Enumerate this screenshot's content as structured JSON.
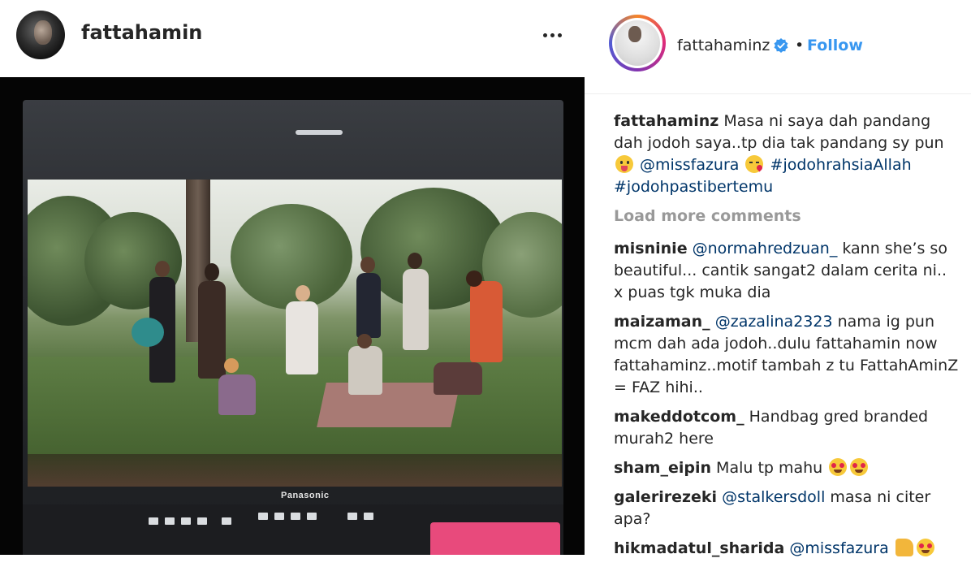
{
  "post": {
    "username": "fattahamin",
    "more_label": "•••"
  },
  "photo": {
    "monitor_brand": "Panasonic"
  },
  "sidebar": {
    "username": "fattahaminz",
    "bullet": "•",
    "follow_label": "Follow",
    "verified_icon": "verified-badge-icon",
    "accent_color": "#3897f0",
    "caption": {
      "username": "fattahaminz",
      "text_1": "Masa ni saya dah pandang dah jodoh saya..tp dia tak pandang sy pun",
      "mention": "@missfazura",
      "tag_1": "#jodohrahsiaAllah",
      "tag_2": "#jodohpastibertemu"
    },
    "load_more": "Load more comments",
    "comments": [
      {
        "username": "misninie",
        "mention": "@normahredzuan_",
        "text": "kann she’s so beautiful... cantik sangat2 dalam cerita ni.. x puas tgk muka dia"
      },
      {
        "username": "maizaman_",
        "mention": "@zazalina2323",
        "text": "nama ig pun mcm dah ada jodoh..dulu fattahamin now fattahaminz..motif tambah z tu FattahAminZ = FAZ hihi.."
      },
      {
        "username": "makeddotcom_",
        "text": "Handbag gred branded murah2 here"
      },
      {
        "username": "sham_eipin",
        "text": "Malu tp mahu"
      },
      {
        "username": "galerirezeki",
        "mention": "@stalkersdoll",
        "text": "masa ni citer apa?"
      },
      {
        "username": "hikmadatul_sharida",
        "mention": "@missfazura"
      }
    ]
  }
}
